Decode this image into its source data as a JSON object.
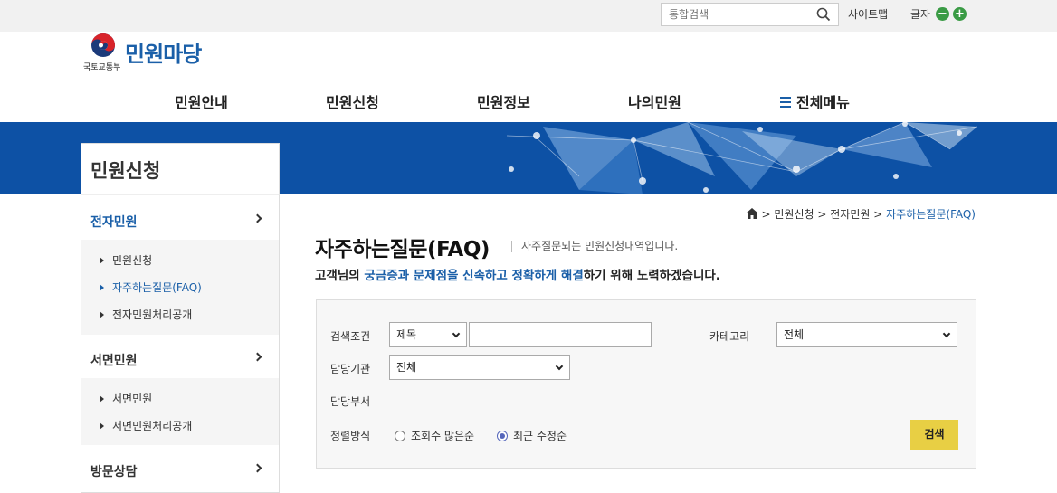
{
  "topbar": {
    "search_placeholder": "통합검색",
    "sitemap_label": "사이트맵",
    "fontsize_label": "글자",
    "fontsize_decrease": "−",
    "fontsize_increase": "+"
  },
  "logo": {
    "ministry": "국토교통부",
    "site_name": "민원마당"
  },
  "gnb": {
    "items": [
      "민원안내",
      "민원신청",
      "민원정보",
      "나의민원"
    ],
    "all_menu_label": "전체메뉴"
  },
  "colors": {
    "brand_blue": "#1a5fa8",
    "banner_blue": "#0d51a5",
    "search_button": "#e8cf44",
    "icon_green": "#3a9b45"
  },
  "lnb": {
    "title": "민원신청",
    "categories": [
      {
        "label": "전자민원",
        "items": [
          "민원신청",
          "자주하는질문(FAQ)",
          "전자민원처리공개"
        ]
      },
      {
        "label": "서면민원",
        "items": [
          "서면민원",
          "서면민원처리공개"
        ]
      },
      {
        "label": "방문상담",
        "items": []
      }
    ]
  },
  "breadcrumb": {
    "items": [
      "민원신청",
      "전자민원",
      "자주하는질문(FAQ)"
    ],
    "sep": ">"
  },
  "page": {
    "title": "자주하는질문(FAQ)",
    "description": "자주질문되는 민원신청내역입니다.",
    "intro_prefix": "고객님의 ",
    "intro_highlight": "궁금증과 문제점을 신속하고 정확하게 해결",
    "intro_suffix": "하기 위해 노력하겠습니다."
  },
  "search": {
    "condition_label": "검색조건",
    "condition_value": "제목",
    "keyword_value": "",
    "category_label": "카테고리",
    "category_value": "전체",
    "agency_label": "담당기관",
    "agency_value": "전체",
    "dept_label": "담당부서",
    "sort_label": "정렬방식",
    "sort_options": [
      "조회수 많은순",
      "최근 수정순"
    ],
    "sort_selected_index": 1,
    "button_label": "검색"
  }
}
